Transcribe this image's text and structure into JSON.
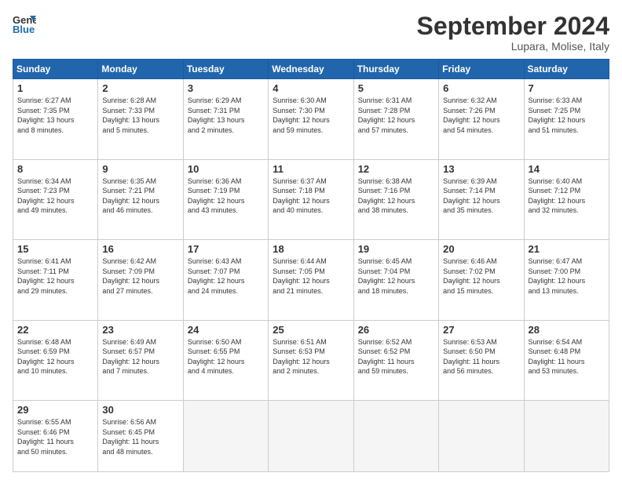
{
  "logo": {
    "line1": "General",
    "line2": "Blue"
  },
  "title": "September 2024",
  "subtitle": "Lupara, Molise, Italy",
  "days_header": [
    "Sunday",
    "Monday",
    "Tuesday",
    "Wednesday",
    "Thursday",
    "Friday",
    "Saturday"
  ],
  "weeks": [
    [
      {
        "day": "1",
        "info": "Sunrise: 6:27 AM\nSunset: 7:35 PM\nDaylight: 13 hours\nand 8 minutes."
      },
      {
        "day": "2",
        "info": "Sunrise: 6:28 AM\nSunset: 7:33 PM\nDaylight: 13 hours\nand 5 minutes."
      },
      {
        "day": "3",
        "info": "Sunrise: 6:29 AM\nSunset: 7:31 PM\nDaylight: 13 hours\nand 2 minutes."
      },
      {
        "day": "4",
        "info": "Sunrise: 6:30 AM\nSunset: 7:30 PM\nDaylight: 12 hours\nand 59 minutes."
      },
      {
        "day": "5",
        "info": "Sunrise: 6:31 AM\nSunset: 7:28 PM\nDaylight: 12 hours\nand 57 minutes."
      },
      {
        "day": "6",
        "info": "Sunrise: 6:32 AM\nSunset: 7:26 PM\nDaylight: 12 hours\nand 54 minutes."
      },
      {
        "day": "7",
        "info": "Sunrise: 6:33 AM\nSunset: 7:25 PM\nDaylight: 12 hours\nand 51 minutes."
      }
    ],
    [
      {
        "day": "8",
        "info": "Sunrise: 6:34 AM\nSunset: 7:23 PM\nDaylight: 12 hours\nand 49 minutes."
      },
      {
        "day": "9",
        "info": "Sunrise: 6:35 AM\nSunset: 7:21 PM\nDaylight: 12 hours\nand 46 minutes."
      },
      {
        "day": "10",
        "info": "Sunrise: 6:36 AM\nSunset: 7:19 PM\nDaylight: 12 hours\nand 43 minutes."
      },
      {
        "day": "11",
        "info": "Sunrise: 6:37 AM\nSunset: 7:18 PM\nDaylight: 12 hours\nand 40 minutes."
      },
      {
        "day": "12",
        "info": "Sunrise: 6:38 AM\nSunset: 7:16 PM\nDaylight: 12 hours\nand 38 minutes."
      },
      {
        "day": "13",
        "info": "Sunrise: 6:39 AM\nSunset: 7:14 PM\nDaylight: 12 hours\nand 35 minutes."
      },
      {
        "day": "14",
        "info": "Sunrise: 6:40 AM\nSunset: 7:12 PM\nDaylight: 12 hours\nand 32 minutes."
      }
    ],
    [
      {
        "day": "15",
        "info": "Sunrise: 6:41 AM\nSunset: 7:11 PM\nDaylight: 12 hours\nand 29 minutes."
      },
      {
        "day": "16",
        "info": "Sunrise: 6:42 AM\nSunset: 7:09 PM\nDaylight: 12 hours\nand 27 minutes."
      },
      {
        "day": "17",
        "info": "Sunrise: 6:43 AM\nSunset: 7:07 PM\nDaylight: 12 hours\nand 24 minutes."
      },
      {
        "day": "18",
        "info": "Sunrise: 6:44 AM\nSunset: 7:05 PM\nDaylight: 12 hours\nand 21 minutes."
      },
      {
        "day": "19",
        "info": "Sunrise: 6:45 AM\nSunset: 7:04 PM\nDaylight: 12 hours\nand 18 minutes."
      },
      {
        "day": "20",
        "info": "Sunrise: 6:46 AM\nSunset: 7:02 PM\nDaylight: 12 hours\nand 15 minutes."
      },
      {
        "day": "21",
        "info": "Sunrise: 6:47 AM\nSunset: 7:00 PM\nDaylight: 12 hours\nand 13 minutes."
      }
    ],
    [
      {
        "day": "22",
        "info": "Sunrise: 6:48 AM\nSunset: 6:59 PM\nDaylight: 12 hours\nand 10 minutes."
      },
      {
        "day": "23",
        "info": "Sunrise: 6:49 AM\nSunset: 6:57 PM\nDaylight: 12 hours\nand 7 minutes."
      },
      {
        "day": "24",
        "info": "Sunrise: 6:50 AM\nSunset: 6:55 PM\nDaylight: 12 hours\nand 4 minutes."
      },
      {
        "day": "25",
        "info": "Sunrise: 6:51 AM\nSunset: 6:53 PM\nDaylight: 12 hours\nand 2 minutes."
      },
      {
        "day": "26",
        "info": "Sunrise: 6:52 AM\nSunset: 6:52 PM\nDaylight: 11 hours\nand 59 minutes."
      },
      {
        "day": "27",
        "info": "Sunrise: 6:53 AM\nSunset: 6:50 PM\nDaylight: 11 hours\nand 56 minutes."
      },
      {
        "day": "28",
        "info": "Sunrise: 6:54 AM\nSunset: 6:48 PM\nDaylight: 11 hours\nand 53 minutes."
      }
    ],
    [
      {
        "day": "29",
        "info": "Sunrise: 6:55 AM\nSunset: 6:46 PM\nDaylight: 11 hours\nand 50 minutes."
      },
      {
        "day": "30",
        "info": "Sunrise: 6:56 AM\nSunset: 6:45 PM\nDaylight: 11 hours\nand 48 minutes."
      },
      {
        "day": "",
        "info": ""
      },
      {
        "day": "",
        "info": ""
      },
      {
        "day": "",
        "info": ""
      },
      {
        "day": "",
        "info": ""
      },
      {
        "day": "",
        "info": ""
      }
    ]
  ]
}
